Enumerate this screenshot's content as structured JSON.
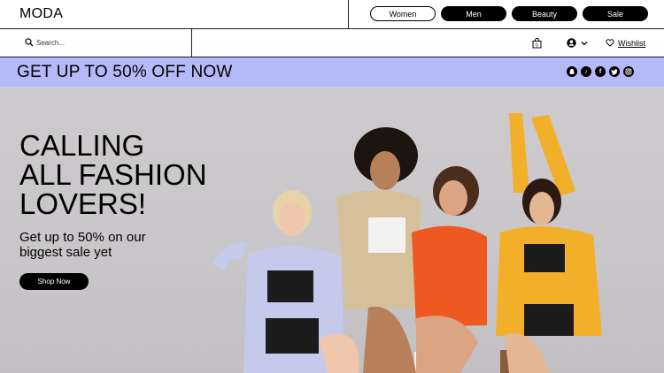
{
  "header": {
    "logo": "MODA",
    "categories": [
      {
        "label": "Women",
        "style": "outline"
      },
      {
        "label": "Men",
        "style": "filled"
      },
      {
        "label": "Beauty",
        "style": "filled"
      },
      {
        "label": "Sale",
        "style": "filled"
      }
    ]
  },
  "search": {
    "placeholder": "Search..."
  },
  "utilities": {
    "wishlist_label": "Wishlist",
    "icons": [
      "shopping-bag-icon",
      "account-icon",
      "chevron-down-icon",
      "heart-icon"
    ]
  },
  "promo": {
    "text": "GET UP TO 50% OFF NOW",
    "background": "#b4b9f8",
    "socials": [
      {
        "name": "snapchat-icon",
        "glyph": "👻"
      },
      {
        "name": "tiktok-icon",
        "glyph": "♪"
      },
      {
        "name": "facebook-icon",
        "glyph": "f"
      },
      {
        "name": "twitter-icon",
        "glyph": "t"
      },
      {
        "name": "instagram-icon",
        "glyph": "◎"
      }
    ]
  },
  "hero": {
    "headline": [
      "CALLING",
      "ALL FASHION",
      "LOVERS!"
    ],
    "subline": "Get up to 50% on our biggest sale yet",
    "cta_label": "Shop Now",
    "figures": [
      {
        "top": "#c9cdee",
        "bottom": "#1b1b1b",
        "hair": "#e9d5a6"
      },
      {
        "top": "#d8c3a1",
        "bottom": "#f1f1f1",
        "hair": "#1b1410"
      },
      {
        "top": "#ef5a22",
        "bottom": "#1b1b1b",
        "hair": "#4a2d1a"
      },
      {
        "top": "#f2b12b",
        "bottom": "#1b1b1b",
        "hair": "#2a1a12"
      }
    ]
  }
}
